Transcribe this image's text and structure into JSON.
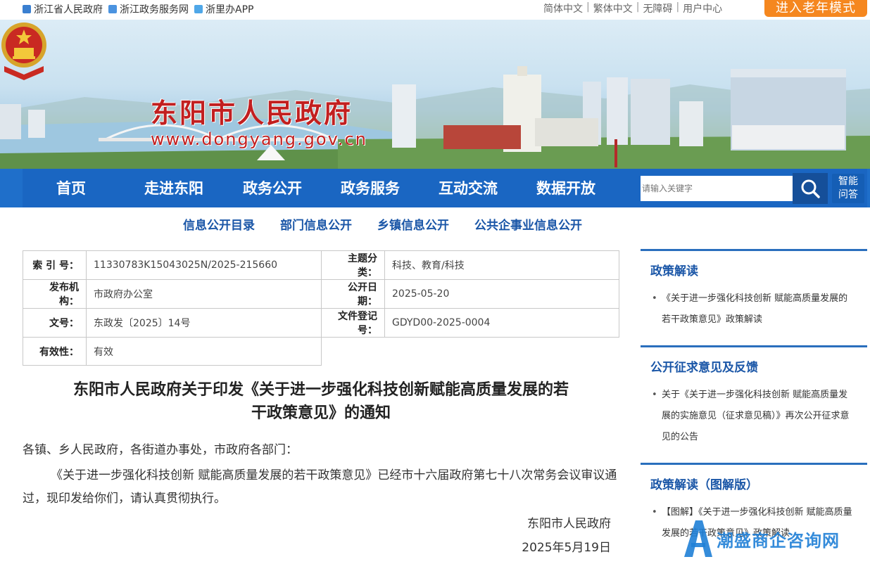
{
  "topbar": {
    "links": [
      "浙江省人民政府",
      "浙江政务服务网",
      "浙里办APP"
    ],
    "lang": [
      "简体中文",
      "繁体中文",
      "无障碍",
      "用户中心"
    ],
    "elder_mode": "进入老年模式"
  },
  "banner": {
    "title": "东阳市人民政府",
    "url": "www.dongyang.gov.cn"
  },
  "nav": {
    "items": [
      "首页",
      "走进东阳",
      "政务公开",
      "政务服务",
      "互动交流",
      "数据开放"
    ],
    "search_placeholder": "请输入关键字",
    "ai_label_1": "智能",
    "ai_label_2": "问答"
  },
  "subnav": [
    "信息公开目录",
    "部门信息公开",
    "乡镇信息公开",
    "公共企事业信息公开"
  ],
  "meta": {
    "index_label": "索 引 号：",
    "index_value": "11330783K15043025N/2025-215660",
    "topic_label": "主题分类：",
    "topic_value": "科技、教育/科技",
    "org_label": "发布机构：",
    "org_value": "市政府办公室",
    "date_label": "公开日期：",
    "date_value": "2025-05-20",
    "docno_label": "文号：",
    "docno_value": "东政发〔2025〕14号",
    "reg_label": "文件登记号：",
    "reg_value": "GDYD00-2025-0004",
    "valid_label": "有效性：",
    "valid_value": "有效"
  },
  "article": {
    "title_line1": "东阳市人民政府关于印发《关于进一步强化科技创新赋能高质量发展的若",
    "title_line2": "干政策意见》的通知",
    "salutation": "各镇、乡人民政府，各街道办事处，市政府各部门：",
    "body": "《关于进一步强化科技创新 赋能高质量发展的若干政策意见》已经市十六届政府第七十八次常务会议审议通过，现印发给你们，请认真贯彻执行。",
    "signature": "东阳市人民政府",
    "date": "2025年5月19日"
  },
  "sidebar": {
    "section1_title": "政策解读",
    "section1_item": "《关于进一步强化科技创新 赋能高质量发展的若干政策意见》政策解读",
    "section2_title": "公开征求意见及反馈",
    "section2_item": "关于《关于进一步强化科技创新 赋能高质量发展的实施意见（征求意见稿）》再次公开征求意见的公告",
    "section3_title": "政策解读（图解版）",
    "section3_item": "【图解】《关于进一步强化科技创新 赋能高质量发展的若干政策意见》政策解读"
  },
  "watermark": "潮盛商企咨询网",
  "colors": {
    "nav_blue": "#1a66c2",
    "title_red": "#c21f1f",
    "elder_orange": "#f5871f",
    "link_blue": "#1a56a7"
  }
}
